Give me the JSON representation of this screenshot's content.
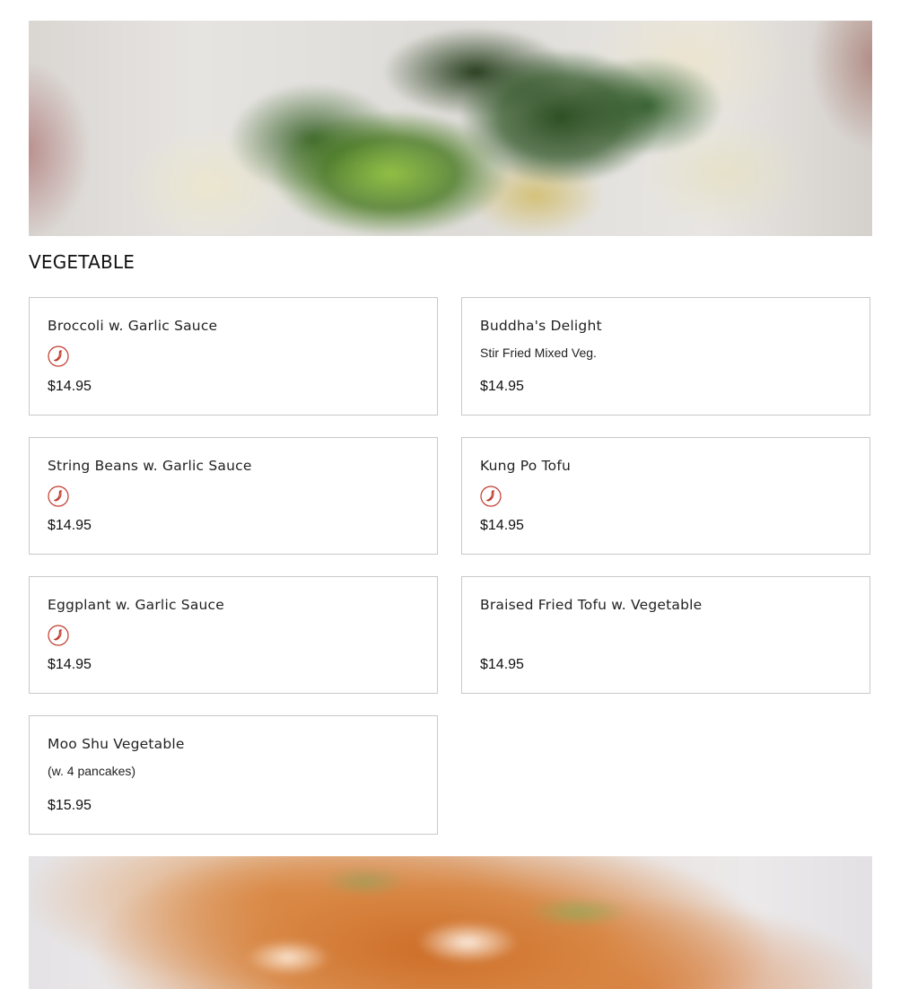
{
  "section": {
    "title": "VEGETABLE"
  },
  "colors": {
    "spicy_icon": "#c0392b",
    "card_border": "#c9c9c9"
  },
  "items": [
    {
      "name": "Broccoli w. Garlic Sauce",
      "description": "",
      "spicy": true,
      "price": "$14.95"
    },
    {
      "name": "Buddha's Delight",
      "description": "Stir Fried Mixed Veg.",
      "spicy": false,
      "price": "$14.95"
    },
    {
      "name": "String Beans w. Garlic Sauce",
      "description": "",
      "spicy": true,
      "price": "$14.95"
    },
    {
      "name": "Kung Po Tofu",
      "description": "",
      "spicy": true,
      "price": "$14.95"
    },
    {
      "name": "Eggplant w. Garlic Sauce",
      "description": "",
      "spicy": true,
      "price": "$14.95"
    },
    {
      "name": "Braised Fried Tofu w. Vegetable",
      "description": "",
      "spicy": false,
      "price": "$14.95"
    },
    {
      "name": "Moo Shu Vegetable",
      "description": "(w. 4 pancakes)",
      "spicy": false,
      "price": "$15.95"
    }
  ],
  "icons": {
    "spicy": "chili-pepper-icon"
  }
}
